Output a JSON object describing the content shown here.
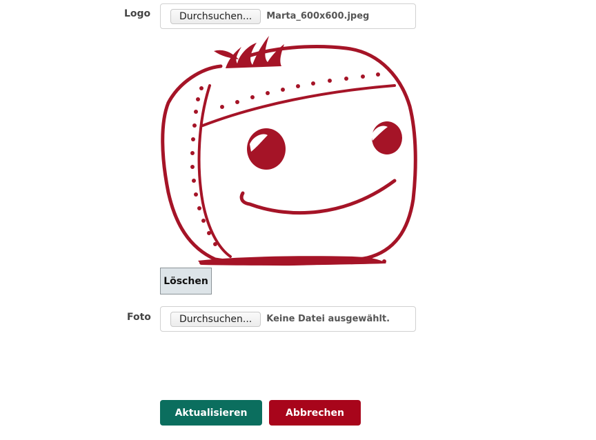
{
  "colors": {
    "primary": "#0b6e5e",
    "danger": "#a8051b",
    "logo": "#a51427"
  },
  "form": {
    "logo": {
      "label": "Logo",
      "browse_label": "Durchsuchen...",
      "file_name": "Marta_600x600.jpeg",
      "delete_label": "Löschen"
    },
    "foto": {
      "label": "Foto",
      "browse_label": "Durchsuchen...",
      "file_name": "Keine Datei ausgewählt."
    },
    "actions": {
      "update_label": "Aktualisieren",
      "cancel_label": "Abbrechen"
    }
  }
}
